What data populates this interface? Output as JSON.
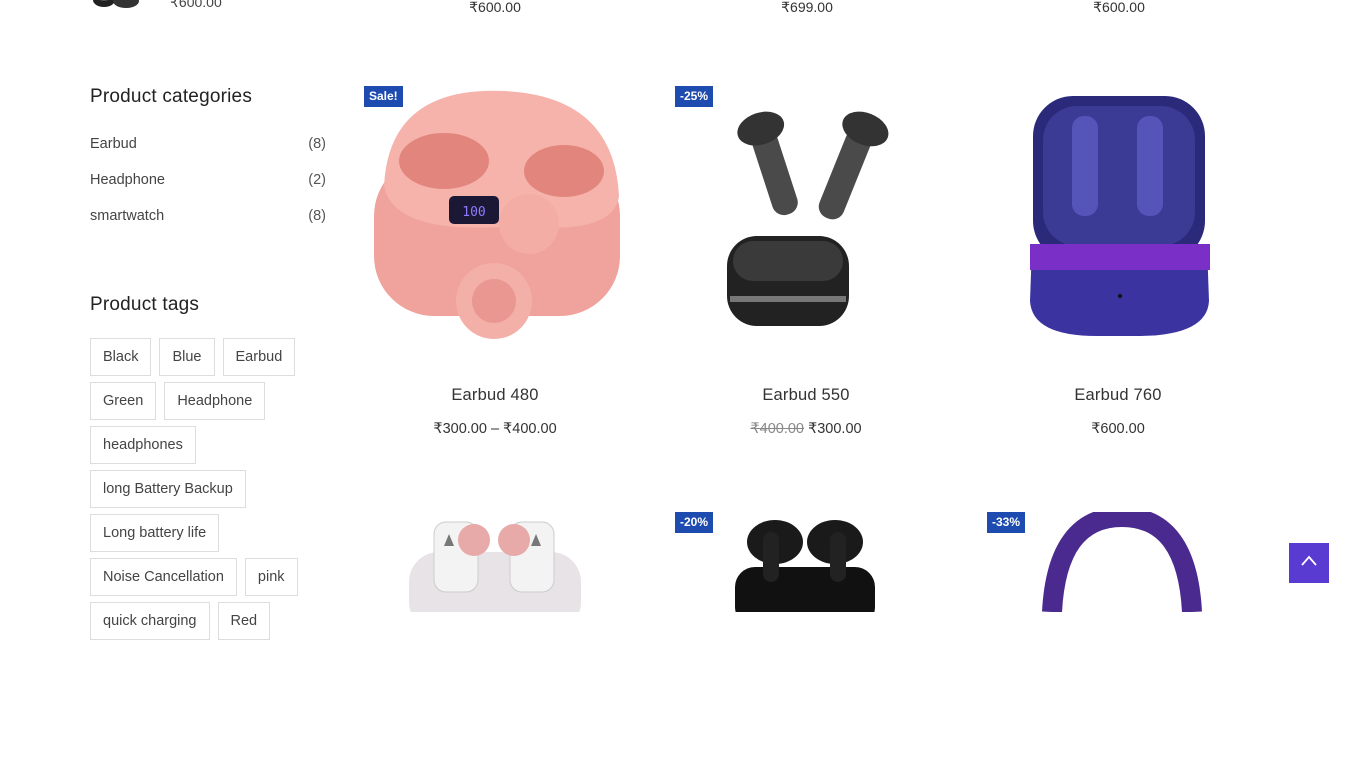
{
  "top_row": {
    "widget_price": "₹600.00",
    "prices": [
      "₹600.00",
      "₹699.00",
      "₹600.00"
    ]
  },
  "sidebar": {
    "categories_title": "Product categories",
    "categories": [
      {
        "label": "Earbud",
        "count": "(8)"
      },
      {
        "label": "Headphone",
        "count": "(2)"
      },
      {
        "label": "smartwatch",
        "count": "(8)"
      }
    ],
    "tags_title": "Product tags",
    "tags": [
      "Black",
      "Blue",
      "Earbud",
      "Green",
      "Headphone",
      "headphones",
      "long Battery Backup",
      "Long battery life",
      "Noise Cancellation",
      "pink",
      "quick charging",
      "Red"
    ]
  },
  "products": [
    {
      "name": "Earbud 480",
      "badge": "Sale!",
      "price": "₹300.00 – ₹400.00",
      "old_price": "",
      "image": "pink-earbuds-case"
    },
    {
      "name": "Earbud 550",
      "badge": "-25%",
      "price": "₹300.00",
      "old_price": "₹400.00",
      "image": "black-earbuds-case"
    },
    {
      "name": "Earbud 760",
      "badge": "",
      "price": "₹600.00",
      "old_price": "",
      "image": "blue-earbuds-case"
    },
    {
      "name": "",
      "badge": "",
      "price": "",
      "old_price": "",
      "image": "white-pink-earbuds-case"
    },
    {
      "name": "",
      "badge": "-20%",
      "price": "",
      "old_price": "",
      "image": "black-earbuds"
    },
    {
      "name": "",
      "badge": "-33%",
      "price": "",
      "old_price": "",
      "image": "purple-headphone"
    }
  ],
  "colors": {
    "badge": "#1e4bb0",
    "scroll_top": "#5a3bd1"
  },
  "scroll_top_icon": "chevron-up-icon"
}
